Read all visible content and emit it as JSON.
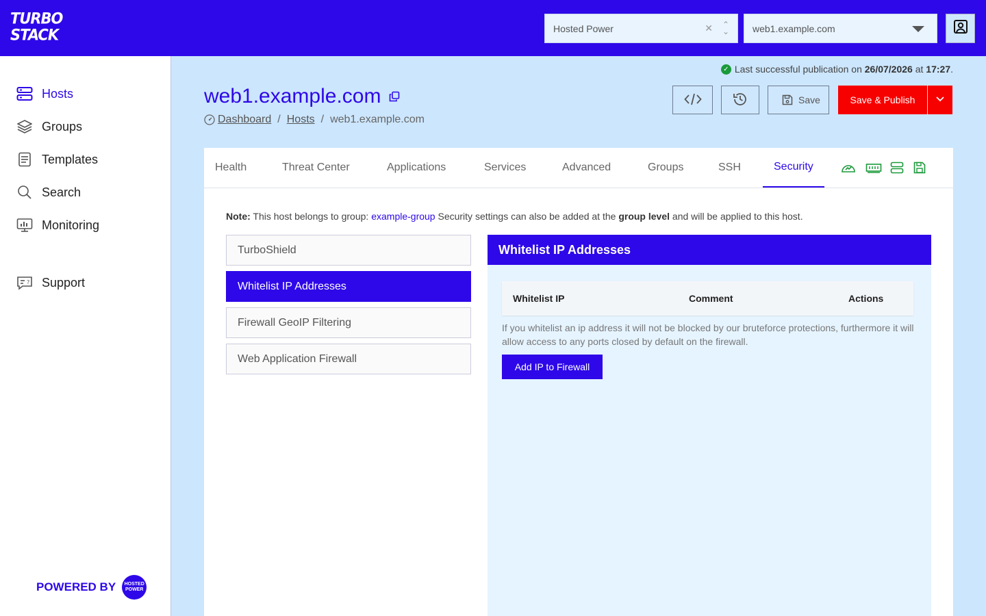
{
  "brand": {
    "logo_line1": "TURBO",
    "logo_line2": "STACK",
    "powered_by": "POWERED BY",
    "powered_badge": "HOSTED POWER"
  },
  "header": {
    "org_select": "Hosted Power",
    "host_select": "web1.example.com"
  },
  "sidebar": {
    "items": [
      {
        "label": "Hosts",
        "icon": "server-icon"
      },
      {
        "label": "Groups",
        "icon": "layers-icon"
      },
      {
        "label": "Templates",
        "icon": "template-icon"
      },
      {
        "label": "Search",
        "icon": "search-icon"
      },
      {
        "label": "Monitoring",
        "icon": "monitor-icon"
      },
      {
        "label": "Support",
        "icon": "support-icon"
      }
    ]
  },
  "status": {
    "prefix": "Last successful publication on",
    "date": "26/07/2026",
    "at": "at",
    "time": "17:27",
    "suffix": "."
  },
  "page": {
    "title": "web1.example.com",
    "breadcrumb": [
      "Dashboard",
      "Hosts",
      "web1.example.com"
    ]
  },
  "toolbar": {
    "save_label": "Save",
    "publish_label": "Save & Publish"
  },
  "tabs": [
    "Health",
    "Threat Center",
    "Applications",
    "Services",
    "Advanced",
    "Groups",
    "SSH",
    "Security"
  ],
  "note": {
    "label": "Note:",
    "text1": "This host belongs to group:",
    "group": "example-group",
    "text2": "Security settings can also be added at the",
    "level": "group level",
    "text3": "and will be applied to this host."
  },
  "security_menu": [
    "TurboShield",
    "Whitelist IP Addresses",
    "Firewall GeoIP Filtering",
    "Web Application Firewall"
  ],
  "whitelist": {
    "title": "Whitelist IP Addresses",
    "columns": [
      "Whitelist IP",
      "Comment",
      "Actions"
    ],
    "help": "If you whitelist an ip address it will not be blocked by our bruteforce protections, furthermore it will allow access to any ports closed by default on the firewall.",
    "add_button": "Add IP to Firewall"
  },
  "colors": {
    "primary": "#2e08e8",
    "danger": "#f70000",
    "background": "#cce6fd",
    "success": "#1a9a3a"
  }
}
